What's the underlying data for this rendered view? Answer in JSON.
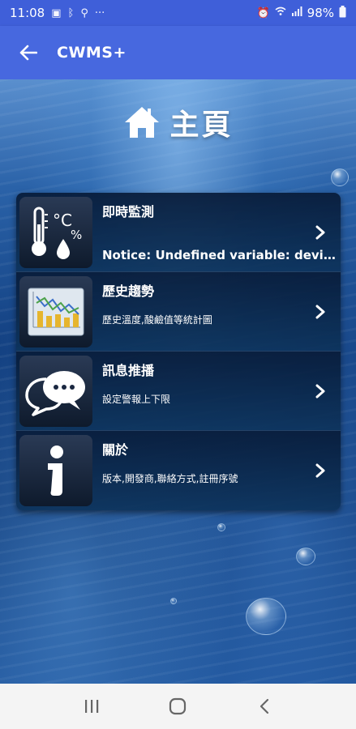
{
  "status_bar": {
    "time": "11:08",
    "more_dots": "···",
    "battery_percent": "98%"
  },
  "app_bar": {
    "title": "CWMS+"
  },
  "page": {
    "title": "主頁"
  },
  "menu": {
    "items": [
      {
        "title": "即時監測",
        "subtitle": "Notice: Undefined variable: devi…",
        "icon": "thermometer-humidity-icon"
      },
      {
        "title": "歷史趨勢",
        "subtitle": "歷史溫度,酸鹼值等統計圖",
        "icon": "bar-chart-icon"
      },
      {
        "title": "訊息推播",
        "subtitle": "設定警報上下限",
        "icon": "chat-bubbles-icon"
      },
      {
        "title": "關於",
        "subtitle": "版本,開發商,聯絡方式,註冊序號",
        "icon": "info-icon"
      }
    ]
  },
  "colors": {
    "app_bar": "#4768df",
    "status_bar": "#3f5fd9",
    "nav_bar": "#f4f4f4"
  }
}
